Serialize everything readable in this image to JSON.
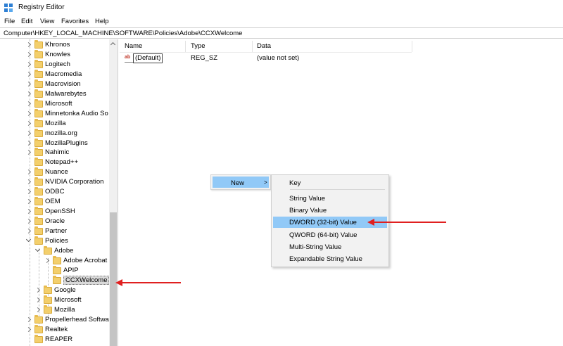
{
  "window": {
    "title": "Registry Editor",
    "icon": "registry-editor-icon"
  },
  "menu": {
    "items": [
      "File",
      "Edit",
      "View",
      "Favorites",
      "Help"
    ]
  },
  "address": {
    "path": "Computer\\HKEY_LOCAL_MACHINE\\SOFTWARE\\Policies\\Adobe\\CCXWelcome"
  },
  "tree": {
    "items": [
      {
        "label": "Khronos",
        "level": 0,
        "expander": "collapsed"
      },
      {
        "label": "Knowles",
        "level": 0,
        "expander": "collapsed"
      },
      {
        "label": "Logitech",
        "level": 0,
        "expander": "collapsed"
      },
      {
        "label": "Macromedia",
        "level": 0,
        "expander": "collapsed"
      },
      {
        "label": "Macrovision",
        "level": 0,
        "expander": "collapsed"
      },
      {
        "label": "Malwarebytes",
        "level": 0,
        "expander": "collapsed"
      },
      {
        "label": "Microsoft",
        "level": 0,
        "expander": "collapsed"
      },
      {
        "label": "Minnetonka Audio So",
        "level": 0,
        "expander": "collapsed"
      },
      {
        "label": "Mozilla",
        "level": 0,
        "expander": "collapsed"
      },
      {
        "label": "mozilla.org",
        "level": 0,
        "expander": "collapsed"
      },
      {
        "label": "MozillaPlugins",
        "level": 0,
        "expander": "collapsed"
      },
      {
        "label": "Nahimic",
        "level": 0,
        "expander": "collapsed"
      },
      {
        "label": "Notepad++",
        "level": 0,
        "expander": "none"
      },
      {
        "label": "Nuance",
        "level": 0,
        "expander": "collapsed"
      },
      {
        "label": "NVIDIA Corporation",
        "level": 0,
        "expander": "collapsed"
      },
      {
        "label": "ODBC",
        "level": 0,
        "expander": "collapsed"
      },
      {
        "label": "OEM",
        "level": 0,
        "expander": "collapsed"
      },
      {
        "label": "OpenSSH",
        "level": 0,
        "expander": "collapsed"
      },
      {
        "label": "Oracle",
        "level": 0,
        "expander": "collapsed"
      },
      {
        "label": "Partner",
        "level": 0,
        "expander": "collapsed"
      },
      {
        "label": "Policies",
        "level": 0,
        "expander": "expanded"
      },
      {
        "label": "Adobe",
        "level": 1,
        "expander": "expanded"
      },
      {
        "label": "Adobe Acrobat",
        "level": 2,
        "expander": "collapsed"
      },
      {
        "label": "APIP",
        "level": 2,
        "expander": "none"
      },
      {
        "label": "CCXWelcome",
        "level": 2,
        "expander": "none",
        "selected": true
      },
      {
        "label": "Google",
        "level": 1,
        "expander": "collapsed"
      },
      {
        "label": "Microsoft",
        "level": 1,
        "expander": "collapsed"
      },
      {
        "label": "Mozilla",
        "level": 1,
        "expander": "collapsed"
      },
      {
        "label": "Propellerhead Softwar",
        "level": 0,
        "expander": "collapsed"
      },
      {
        "label": "Realtek",
        "level": 0,
        "expander": "collapsed"
      },
      {
        "label": "REAPER",
        "level": 0,
        "expander": "none"
      }
    ]
  },
  "list": {
    "columns": {
      "name": "Name",
      "type": "Type",
      "data": "Data"
    },
    "values": [
      {
        "name": "(Default)",
        "type": "REG_SZ",
        "data": "(value not set)",
        "icon": "string-value-icon"
      }
    ]
  },
  "context_menu": {
    "new_label": "New",
    "new_arrow": ">",
    "submenu": [
      {
        "label": "Key",
        "highlighted": false
      },
      {
        "label": "String Value",
        "highlighted": false
      },
      {
        "label": "Binary Value",
        "highlighted": false
      },
      {
        "label": "DWORD (32-bit) Value",
        "highlighted": true
      },
      {
        "label": "QWORD (64-bit) Value",
        "highlighted": false
      },
      {
        "label": "Multi-String Value",
        "highlighted": false
      },
      {
        "label": "Expandable String Value",
        "highlighted": false
      }
    ]
  },
  "colors": {
    "annotation_arrow": "#e02020",
    "menu_highlight": "#91c9f7",
    "folder": "#f3cf6c"
  }
}
